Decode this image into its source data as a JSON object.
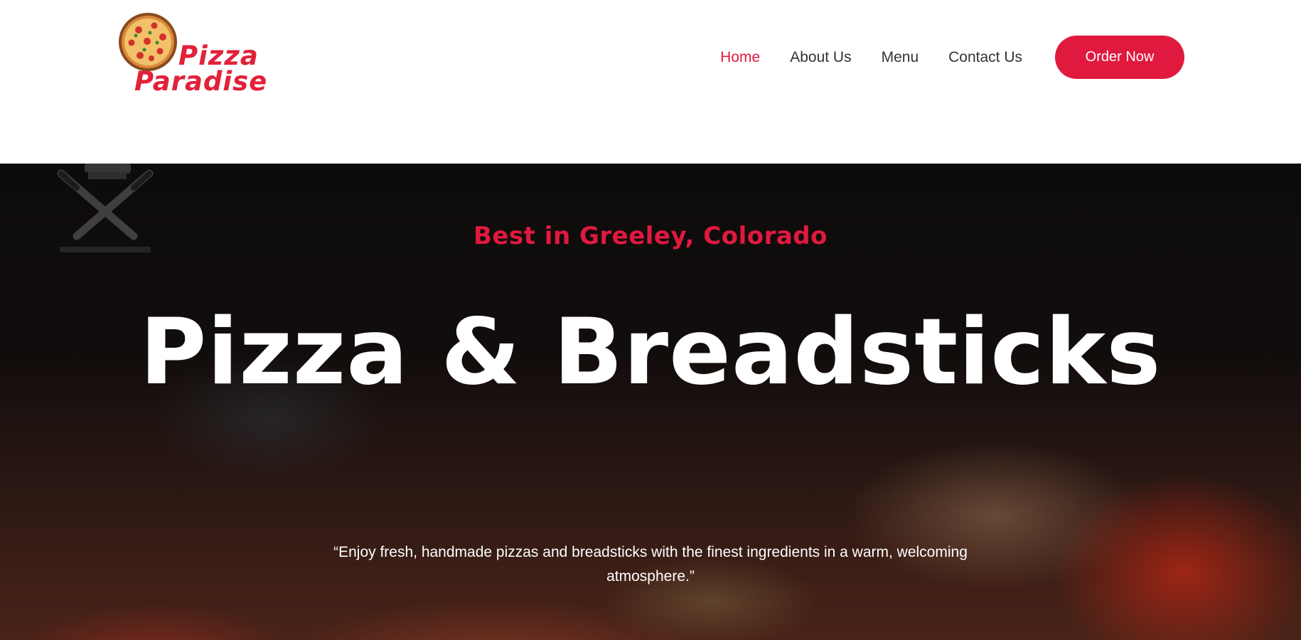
{
  "brand": {
    "name_line1": "Pizza",
    "name_line2": "Paradise",
    "logo_icon": "pizza-icon",
    "logo_color": "#e2213a"
  },
  "nav": {
    "items": [
      {
        "label": "Home",
        "active": true
      },
      {
        "label": "About Us",
        "active": false
      },
      {
        "label": "Menu",
        "active": false
      },
      {
        "label": "Contact Us",
        "active": false
      }
    ],
    "cta_label": "Order Now"
  },
  "hero": {
    "subtitle": "Best in Greeley, Colorado",
    "title": "Pizza & Breadsticks",
    "quote": "“Enjoy fresh, handmade pizzas and breadsticks with the finest ingredients in a warm, welcoming atmosphere.”",
    "watermark_icon": "chef-knives-icon"
  },
  "colors": {
    "accent": "#e0193f",
    "nav_text": "#333333",
    "hero_text": "#ffffff"
  }
}
